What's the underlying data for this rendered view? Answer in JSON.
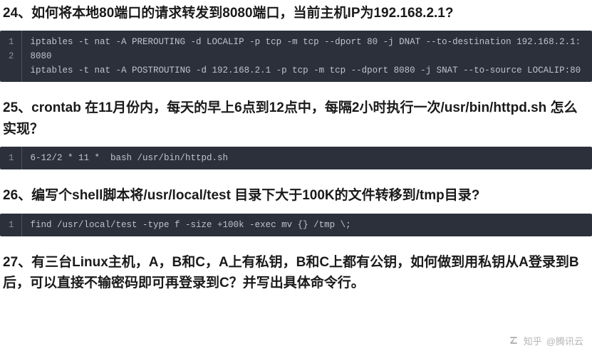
{
  "sections": [
    {
      "heading": "24、如何将本地80端口的请求转发到8080端口，当前主机IP为192.168.2.1?",
      "code": {
        "line_numbers": [
          "1",
          "2"
        ],
        "lines_display": [
          "iptables -t nat -A PREROUTING -d LOCALIP -p tcp -m tcp --dport 80 -j DNAT --to-destination 192.168.2.1:8080",
          "iptables -t nat -A POSTROUTING -d 192.168.2.1 -p tcp -m tcp --dport 8080 -j SNAT --to-source LOCALIP:80"
        ]
      }
    },
    {
      "heading": "25、crontab 在11月份内，每天的早上6点到12点中，每隔2小时执行一次/usr/bin/httpd.sh 怎么实现？",
      "code": {
        "line_numbers": [
          "1"
        ],
        "lines_display": [
          "6-12/2 * 11 *  bash /usr/bin/httpd.sh"
        ]
      }
    },
    {
      "heading": "26、编写个shell脚本将/usr/local/test 目录下大于100K的文件转移到/tmp目录?",
      "code": {
        "line_numbers": [
          "1"
        ],
        "lines_display": [
          "find /usr/local/test -type f -size +100k -exec mv {} /tmp \\;"
        ]
      }
    },
    {
      "heading": "27、有三台Linux主机，A，B和C，A上有私钥，B和C上都有公钥，如何做到用私钥从A登录到B后，可以直接不输密码即可再登录到C？并写出具体命令行。",
      "code": null
    }
  ],
  "watermark": {
    "brand": "知乎",
    "author": "@腾讯云"
  }
}
